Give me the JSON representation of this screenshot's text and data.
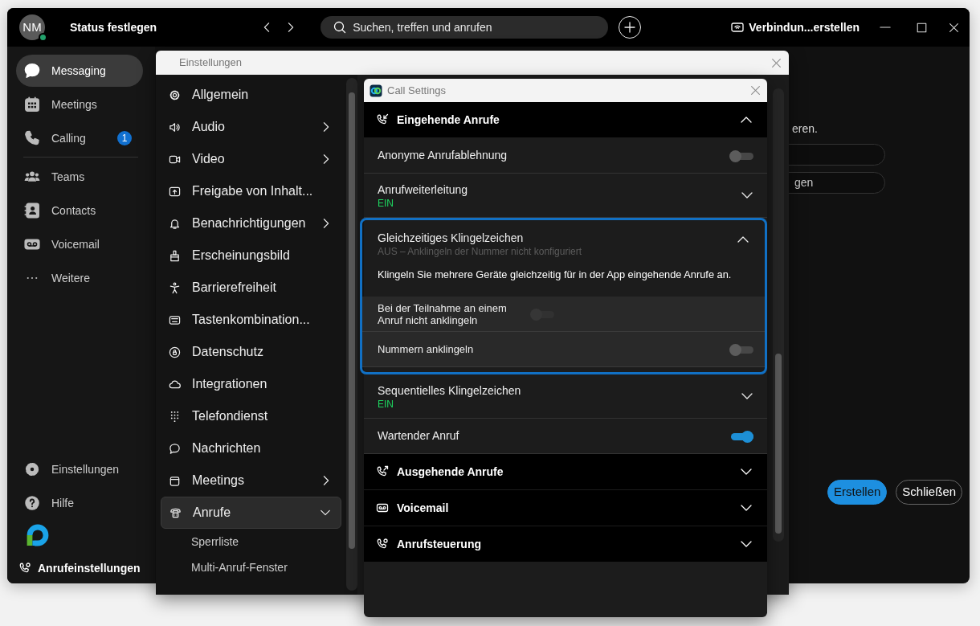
{
  "main_window": {
    "avatar": "NM",
    "status_label": "Status festlegen",
    "search": {
      "placeholder": "Suchen, treffen und anrufen"
    },
    "connect_label": "Verbindun...erstellen"
  },
  "sidebar": {
    "groups": [
      [
        {
          "label": "Messaging",
          "selected": true
        },
        {
          "label": "Meetings",
          "selected": false
        },
        {
          "label": "Calling",
          "selected": false,
          "badge": "1"
        }
      ],
      [
        {
          "label": "Teams",
          "selected": false
        },
        {
          "label": "Contacts",
          "selected": false
        },
        {
          "label": "Voicemail",
          "selected": false
        },
        {
          "label": "Weitere",
          "selected": false
        }
      ]
    ],
    "footer": [
      {
        "label": "Einstellungen"
      },
      {
        "label": "Hilfe"
      }
    ],
    "status_bar": "Anrufeinstellungen"
  },
  "background": {
    "text": "eren.",
    "fields": [
      {
        "kind": "field"
      },
      {
        "kind": "field",
        "value": "gen"
      }
    ],
    "buttons": [
      {
        "label": "Erstellen",
        "primary": true
      },
      {
        "label": "Schließen",
        "primary": false
      }
    ]
  },
  "settings_dialog": {
    "title": "Einstellungen",
    "nav": [
      {
        "label": "Allgemein",
        "submenu": false,
        "selected": false
      },
      {
        "label": "Audio",
        "submenu": true,
        "selected": false
      },
      {
        "label": "Video",
        "submenu": true,
        "selected": false
      },
      {
        "label": "Freigabe von Inhalt...",
        "submenu": false,
        "selected": false
      },
      {
        "label": "Benachrichtigungen",
        "submenu": true,
        "selected": false
      },
      {
        "label": "Erscheinungsbild",
        "submenu": false,
        "selected": false
      },
      {
        "label": "Barrierefreiheit",
        "submenu": false,
        "selected": false
      },
      {
        "label": "Tastenkombination...",
        "submenu": false,
        "selected": false
      },
      {
        "label": "Datenschutz",
        "submenu": false,
        "selected": false
      },
      {
        "label": "Integrationen",
        "submenu": false,
        "selected": false
      },
      {
        "label": "Telefondienst",
        "submenu": false,
        "selected": false
      },
      {
        "label": "Nachrichten",
        "submenu": false,
        "selected": false
      },
      {
        "label": "Meetings",
        "submenu": true,
        "selected": false
      },
      {
        "label": "Anrufe",
        "submenu": true,
        "selected": true,
        "expanded": true,
        "children": [
          {
            "label": "Sperrliste"
          },
          {
            "label": "Multi-Anruf-Fenster"
          }
        ]
      }
    ]
  },
  "call_settings": {
    "title": "Call Settings",
    "sections": [
      {
        "title": "Eingehende Anrufe",
        "expanded": true,
        "items": [
          {
            "kind": "toggle",
            "label": "Anonyme Anrufablehnung",
            "on": false
          },
          {
            "kind": "expander",
            "label": "Anrufweiterleitung",
            "status": "EIN",
            "on": true,
            "expanded": false
          },
          {
            "kind": "group",
            "label": "Gleichzeitiges Klingelzeichen",
            "status": "AUS – Anklingeln der Nummer nicht konfiguriert",
            "on": false,
            "expanded": true,
            "focused": true,
            "description": "Klingeln Sie mehrere Geräte gleichzeitig für in der App eingehende Anrufe an.",
            "items": [
              {
                "kind": "toggle",
                "label": "Bei der Teilnahme an einem Anruf nicht anklingeln",
                "on": false,
                "disabled": true
              },
              {
                "kind": "toggle",
                "label": "Nummern anklingeln",
                "on": false,
                "disabled": false
              }
            ]
          },
          {
            "kind": "expander",
            "label": "Sequentielles Klingelzeichen",
            "status": "EIN",
            "on": true,
            "expanded": false
          },
          {
            "kind": "toggle",
            "label": "Wartender Anruf",
            "on": true
          }
        ]
      },
      {
        "title": "Ausgehende Anrufe",
        "expanded": false
      },
      {
        "title": "Voicemail",
        "expanded": false
      },
      {
        "title": "Anrufsteuerung",
        "expanded": false
      }
    ]
  }
}
